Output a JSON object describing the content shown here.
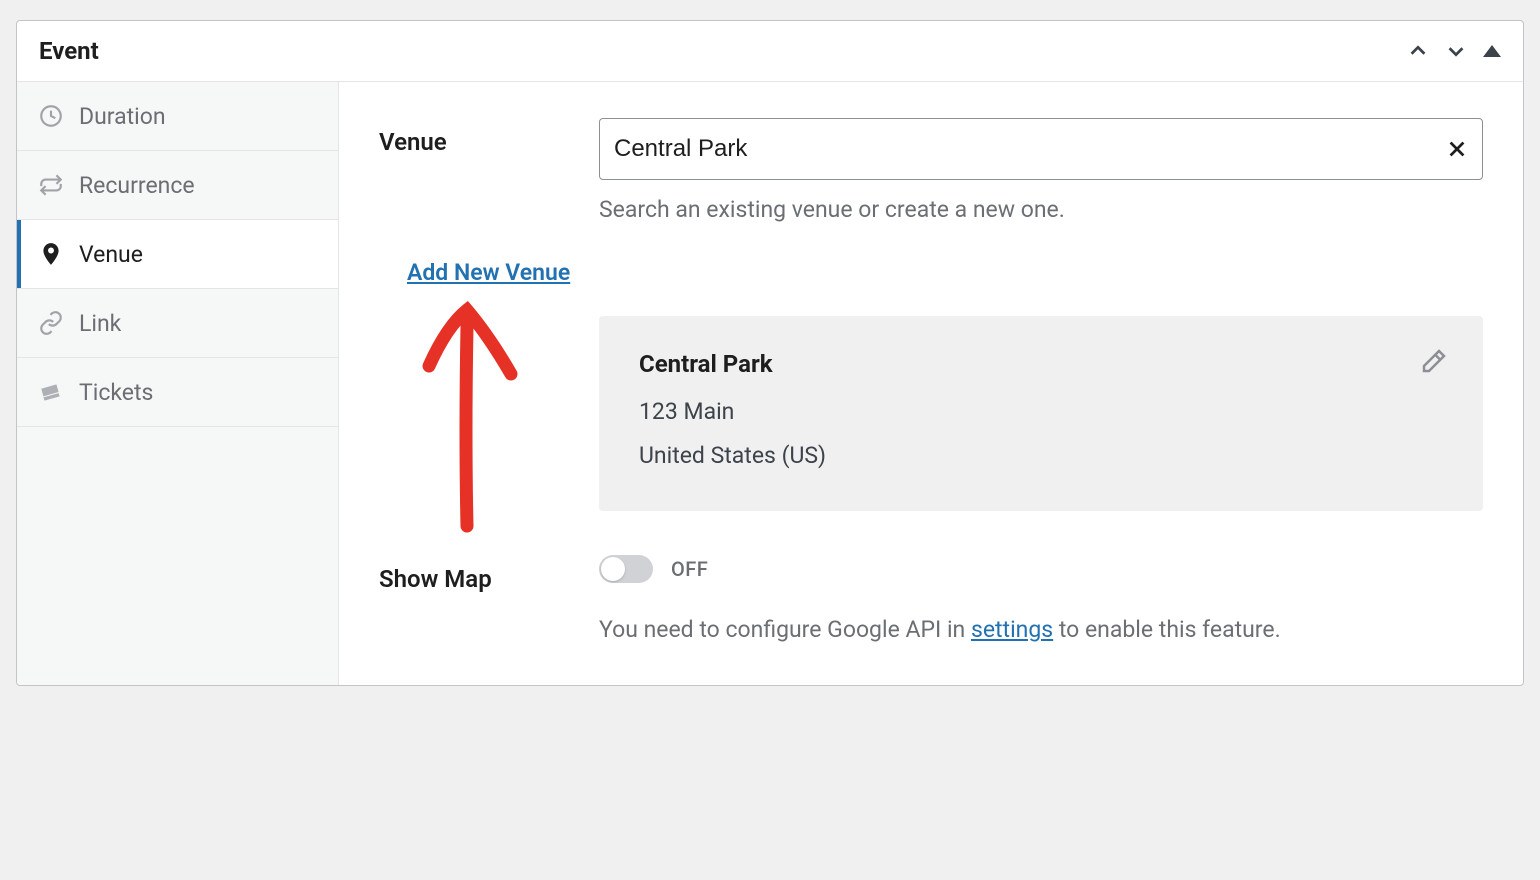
{
  "panel": {
    "title": "Event"
  },
  "sidebar": {
    "items": [
      {
        "label": "Duration"
      },
      {
        "label": "Recurrence"
      },
      {
        "label": "Venue"
      },
      {
        "label": "Link"
      },
      {
        "label": "Tickets"
      }
    ]
  },
  "venue": {
    "label": "Venue",
    "input_value": "Central Park",
    "help": "Search an existing venue or create a new one.",
    "add_new_label": "Add New Venue",
    "card": {
      "name": "Central Park",
      "address": "123 Main",
      "country": "United States (US)"
    }
  },
  "show_map": {
    "label": "Show Map",
    "state_label": "OFF",
    "note_prefix": "You need to configure Google API in ",
    "note_link": "settings",
    "note_suffix": " to enable this feature."
  }
}
